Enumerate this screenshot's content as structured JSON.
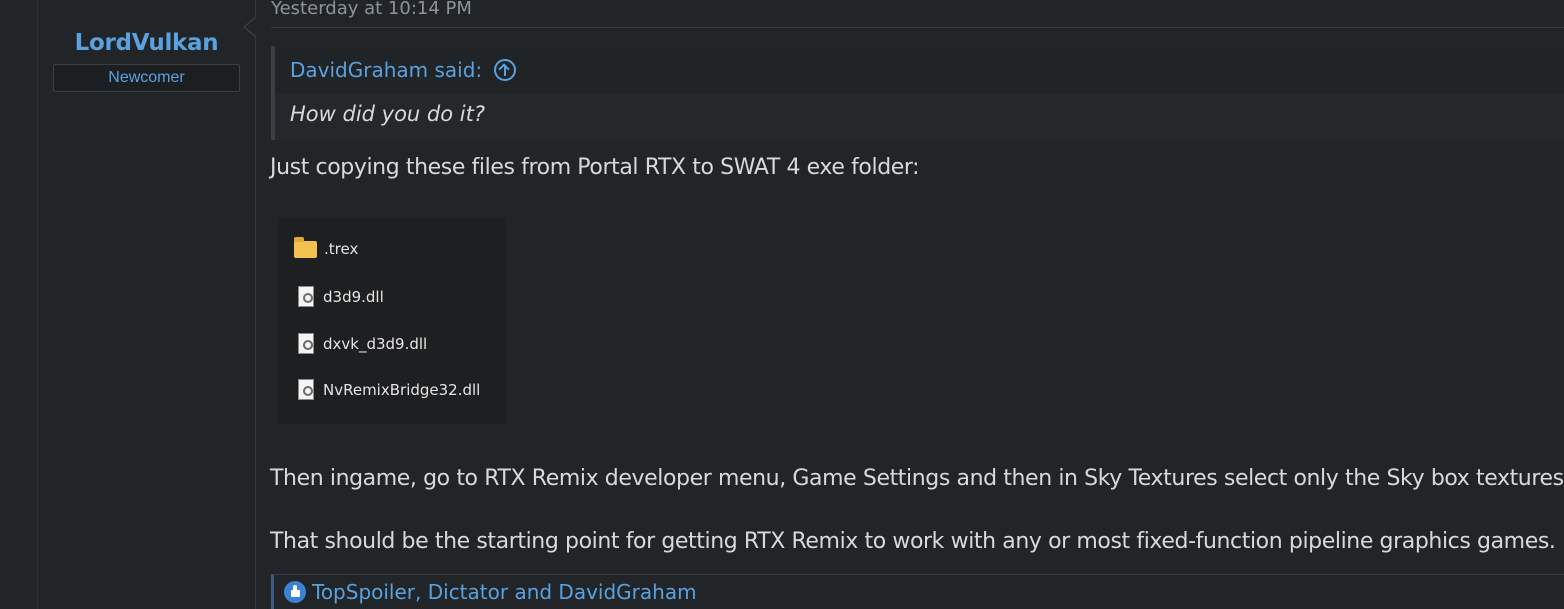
{
  "user": {
    "name": "LordVulkan",
    "title": "Newcomer"
  },
  "post": {
    "timestamp": "Yesterday at 10:14 PM",
    "quote": {
      "author_line": "DavidGraham said:",
      "text": "How did you do it?"
    },
    "paragraph1": "Just copying these files from Portal RTX to SWAT 4 exe folder:",
    "files": [
      {
        "name": ".trex",
        "icon": "folder-icon"
      },
      {
        "name": "d3d9.dll",
        "icon": "dll-file-icon"
      },
      {
        "name": "dxvk_d3d9.dll",
        "icon": "dll-file-icon"
      },
      {
        "name": "NvRemixBridge32.dll",
        "icon": "dll-file-icon"
      }
    ],
    "paragraph2": "Then ingame, go to RTX Remix developer menu, Game Settings and then in Sky Textures select only the Sky box textures.",
    "paragraph3": "That should be the starting point for getting RTX Remix to work with any or most fixed-function pipeline graphics games.",
    "reactions": "TopSpoiler, Dictator and DavidGraham"
  },
  "colors": {
    "accent": "#5aa1df",
    "background": "#222527",
    "text": "#d7d9db",
    "muted": "#8d939a"
  }
}
